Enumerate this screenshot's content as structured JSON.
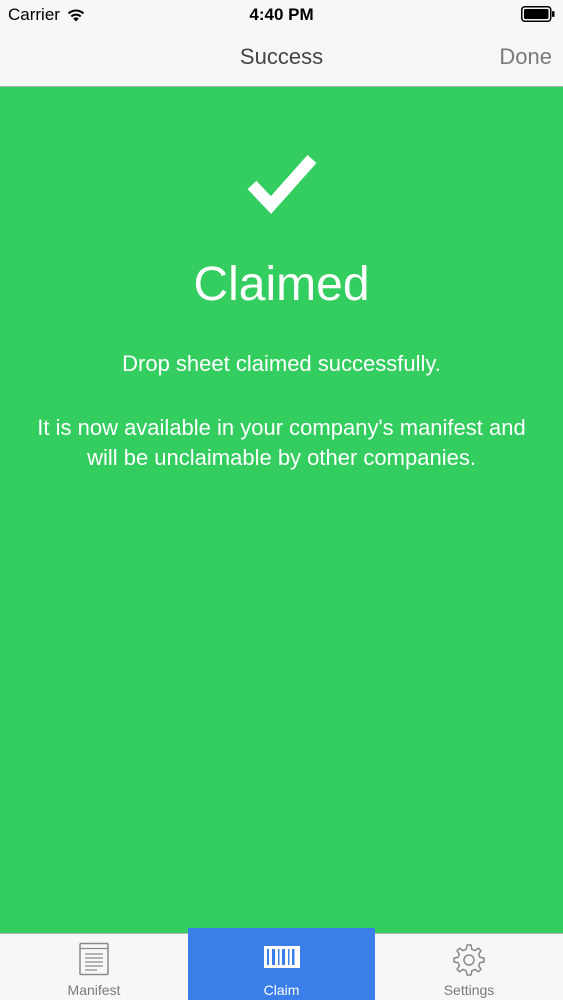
{
  "status_bar": {
    "carrier": "Carrier",
    "time": "4:40 PM",
    "wifi_icon": "wifi-icon",
    "battery_icon": "battery-icon"
  },
  "nav": {
    "title": "Success",
    "done_label": "Done"
  },
  "content": {
    "icon": "checkmark-icon",
    "title": "Claimed",
    "message_1": "Drop sheet claimed successfully.",
    "message_2": "It is now available in your company's manifest and will be unclaimable by other companies.",
    "background_color": "#34cd60"
  },
  "tab_bar": {
    "selected": "Claim",
    "accent_color": "#3a7ee9",
    "tabs": [
      {
        "label": "Manifest",
        "icon": "document-list-icon"
      },
      {
        "label": "Claim",
        "icon": "barcode-icon"
      },
      {
        "label": "Settings",
        "icon": "gear-icon"
      }
    ]
  }
}
